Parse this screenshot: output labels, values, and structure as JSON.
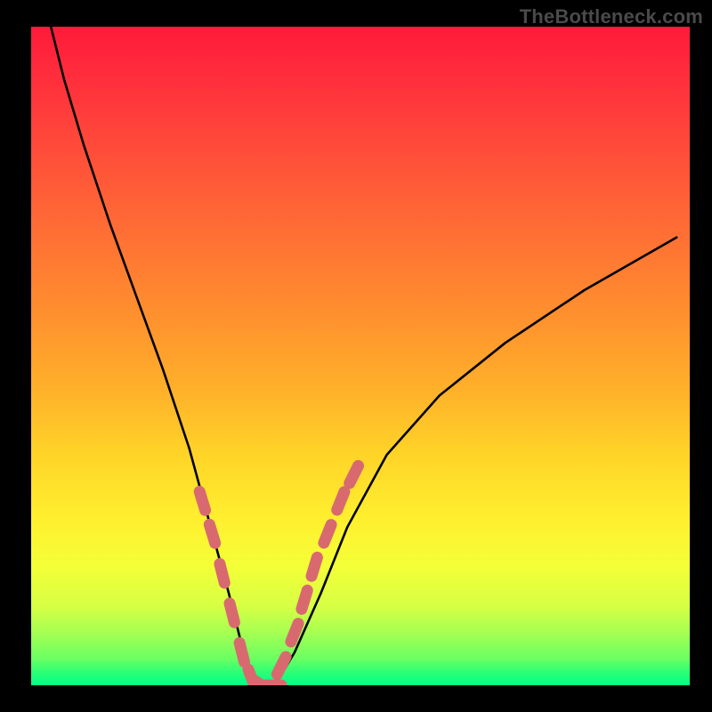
{
  "watermark": "TheBottleneck.com",
  "colors": {
    "background": "#000000",
    "curve": "#000000",
    "marker": "#d86a6f"
  },
  "chart_data": {
    "type": "line",
    "title": "",
    "xlabel": "",
    "ylabel": "",
    "xlim": [
      0,
      100
    ],
    "ylim": [
      0,
      100
    ],
    "grid": false,
    "annotations": [
      "TheBottleneck.com"
    ],
    "series": [
      {
        "name": "bottleneck-curve",
        "x": [
          3,
          5,
          8,
          12,
          16,
          20,
          24,
          27,
          30,
          32,
          34,
          37,
          40,
          44,
          48,
          54,
          62,
          72,
          84,
          98
        ],
        "values": [
          100,
          92,
          82,
          70,
          59,
          48,
          36,
          25,
          14,
          6,
          0,
          0,
          5,
          14,
          24,
          35,
          44,
          52,
          60,
          68
        ]
      }
    ],
    "markers": {
      "name": "highlighted-points",
      "x": [
        26,
        27.5,
        29,
        30.5,
        32,
        33.5,
        35,
        36.5,
        38,
        40,
        41.5,
        43,
        45,
        47,
        49
      ],
      "values": [
        28,
        23,
        17,
        11,
        5,
        1,
        0,
        0,
        3,
        8,
        13,
        18,
        23,
        28,
        32
      ]
    }
  }
}
